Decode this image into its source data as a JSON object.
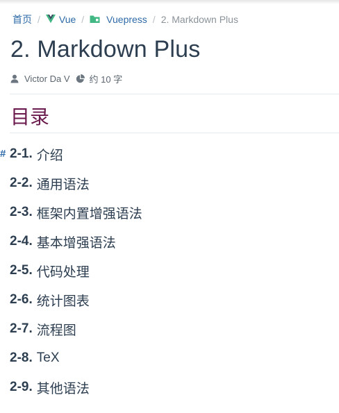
{
  "breadcrumb": {
    "home": "首页",
    "vue": "Vue",
    "vuepress": "Vuepress",
    "current": "2. Markdown Plus",
    "separator": "/"
  },
  "page": {
    "title": "2. Markdown Plus"
  },
  "meta": {
    "author": "Victor Da V",
    "word_count": "约 10 字"
  },
  "toc": {
    "heading": "目录",
    "anchor_symbol": "#",
    "items": [
      {
        "num": "2-1.",
        "text": "介绍"
      },
      {
        "num": "2-2.",
        "text": "通用语法"
      },
      {
        "num": "2-3.",
        "text": "框架内置增强语法"
      },
      {
        "num": "2-4.",
        "text": "基本增强语法"
      },
      {
        "num": "2-5.",
        "text": "代码处理"
      },
      {
        "num": "2-6.",
        "text": "统计图表"
      },
      {
        "num": "2-7.",
        "text": "流程图"
      },
      {
        "num": "2-8.",
        "text": "TeX"
      },
      {
        "num": "2-9.",
        "text": "其他语法"
      }
    ]
  },
  "colors": {
    "link": "#2e6aa8",
    "text": "#2c3e50",
    "muted": "#8a9299",
    "toc_heading": "#6b1a4d",
    "vue_green": "#41b883",
    "vue_dark": "#35495e"
  },
  "icons": {
    "vue": "vue-logo-icon",
    "vuepress": "folder-icon",
    "author": "person-icon",
    "word_count": "pie-chart-icon"
  }
}
